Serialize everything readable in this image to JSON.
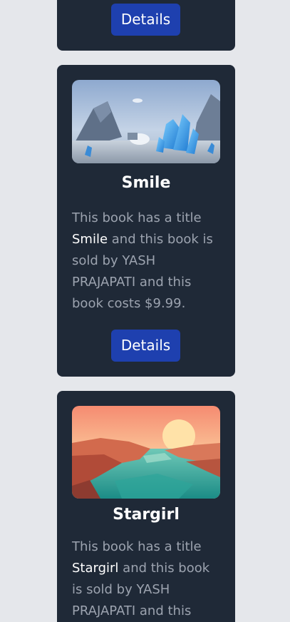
{
  "cards": [
    {
      "button_label": "Details"
    },
    {
      "title": "Smile",
      "desc_prefix": "This book has a title ",
      "desc_title": "Smile",
      "desc_suffix": " and this book is sold by YASH PRAJAPATI and this book costs $9.99.",
      "button_label": "Details"
    },
    {
      "title": "Stargirl",
      "desc_prefix": "This book has a title ",
      "desc_title": "Stargirl",
      "desc_suffix": " and this book is sold by YASH PRAJAPATI and this"
    }
  ]
}
